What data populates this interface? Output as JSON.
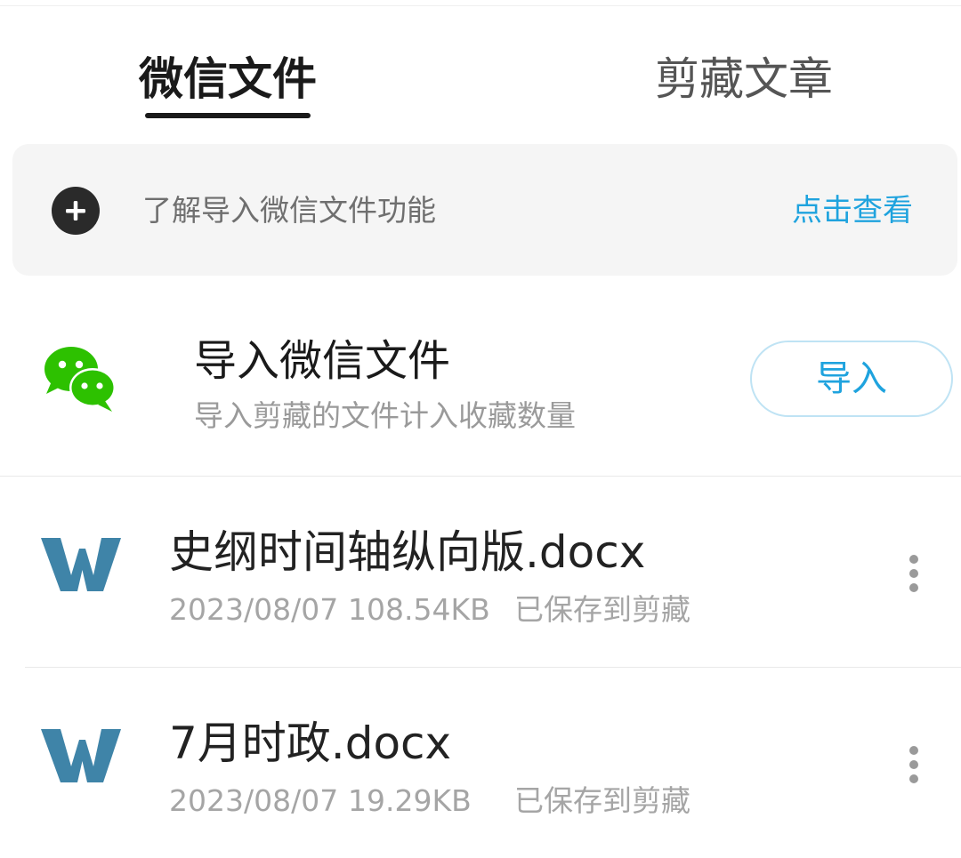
{
  "tabs": {
    "active_label": "微信文件",
    "inactive_label": "剪藏文章"
  },
  "banner": {
    "text": "了解导入微信文件功能",
    "link_label": "点击查看",
    "icon": "plus-circle-icon"
  },
  "import_section": {
    "icon": "wechat-icon",
    "title": "导入微信文件",
    "subtitle": "导入剪藏的文件计入收藏数量",
    "button_label": "导入"
  },
  "files": [
    {
      "icon": "word-doc-icon",
      "name": "史纲时间轴纵向版.docx",
      "date": "2023/08/07",
      "size": "108.54KB",
      "status": "已保存到剪藏"
    },
    {
      "icon": "word-doc-icon",
      "name": "7月时政.docx",
      "date": "2023/08/07",
      "size": "19.29KB",
      "status": "已保存到剪藏"
    }
  ],
  "colors": {
    "accent": "#1fa3de",
    "wechat_green": "#2dc100",
    "word_blue": "#3f84a8",
    "text_primary": "#1a1a1a",
    "text_secondary": "#9a9a9a"
  }
}
